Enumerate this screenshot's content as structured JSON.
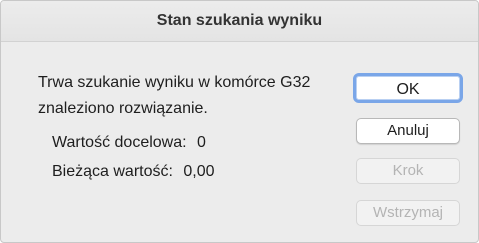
{
  "dialog": {
    "title": "Stan szukania wyniku",
    "message_line1": "Trwa szukanie wyniku w komórce G32",
    "message_line2": "znaleziono rozwiązanie.",
    "target_label": "Wartość docelowa:",
    "target_value": "0",
    "current_label": "Bieżąca wartość:",
    "current_value": "0,00"
  },
  "buttons": {
    "ok": "OK",
    "cancel": "Anuluj",
    "step": "Krok",
    "pause": "Wstrzymaj"
  },
  "colors": {
    "default_button_border": "#7aa6e8",
    "disabled_text": "#b4b4b4"
  }
}
